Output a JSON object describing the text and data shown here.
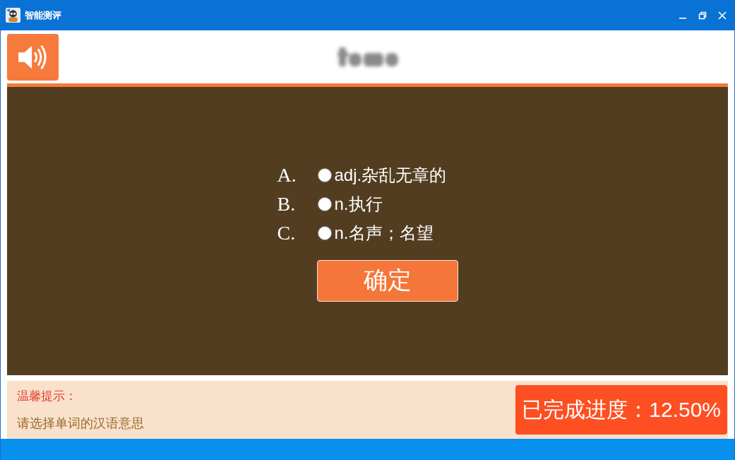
{
  "window": {
    "title": "智能测评"
  },
  "header": {
    "word_blurred": true
  },
  "question": {
    "options": [
      {
        "letter": "A.",
        "text": "adj.杂乱无章的",
        "selected": false
      },
      {
        "letter": "B.",
        "text": "n.执行",
        "selected": false
      },
      {
        "letter": "C.",
        "text": "n.名声；名望",
        "selected": false
      }
    ],
    "confirm_button": "确定"
  },
  "hint": {
    "title": "温馨提示：",
    "text": "请选择单词的汉语意思"
  },
  "progress": {
    "label": "已完成进度：12.50%"
  }
}
